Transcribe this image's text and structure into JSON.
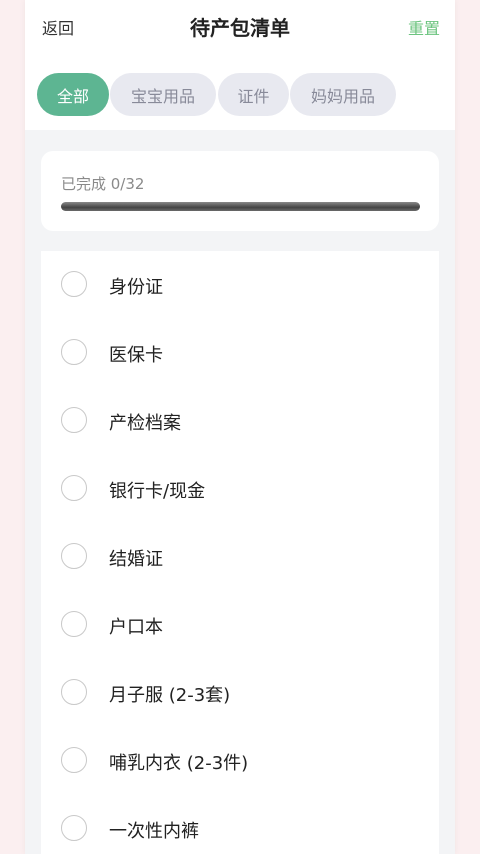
{
  "header": {
    "back_label": "返回",
    "title": "待产包清单",
    "reset_label": "重置"
  },
  "tabs": [
    {
      "label": "全部",
      "active": true
    },
    {
      "label": "宝宝用品",
      "active": false
    },
    {
      "label": "证件",
      "active": false
    },
    {
      "label": "妈妈用品",
      "active": false
    }
  ],
  "progress": {
    "label": "已完成 0/32",
    "completed": 0,
    "total": 32
  },
  "items": [
    {
      "label": "身份证",
      "checked": false
    },
    {
      "label": "医保卡",
      "checked": false
    },
    {
      "label": "产检档案",
      "checked": false
    },
    {
      "label": "银行卡/现金",
      "checked": false
    },
    {
      "label": "结婚证",
      "checked": false
    },
    {
      "label": "户口本",
      "checked": false
    },
    {
      "label": "月子服 (2-3套)",
      "checked": false
    },
    {
      "label": "哺乳内衣 (2-3件)",
      "checked": false
    },
    {
      "label": "一次性内裤",
      "checked": false
    }
  ],
  "colors": {
    "accent": "#5db592",
    "reset": "#6cc47f",
    "tab_inactive_bg": "#e8e9f0"
  }
}
